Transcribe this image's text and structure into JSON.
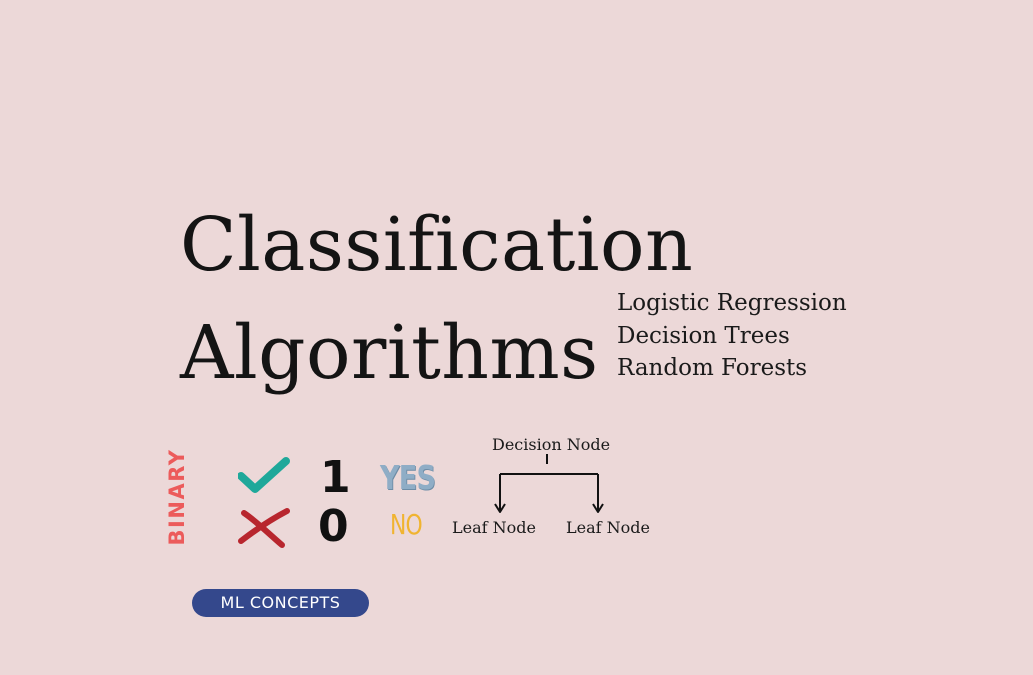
{
  "title": {
    "line1": "Classification",
    "line2": "Algorithms"
  },
  "algorithms": [
    "Logistic Regression",
    "Decision Trees",
    "Random Forests"
  ],
  "binary": {
    "label": "BINARY",
    "one": "1",
    "zero": "0",
    "yes": "YES",
    "no": "NO",
    "icons": [
      "check-icon",
      "cross-icon"
    ]
  },
  "tree": {
    "decision_node": "Decision Node",
    "leaf_left": "Leaf Node",
    "leaf_right": "Leaf Node"
  },
  "badge": "ML CONCEPTS",
  "colors": {
    "background": "#ecd8d8",
    "binary_label": "#ec5b5b",
    "check": "#1fa89a",
    "cross": "#b8262e",
    "yes": "#8fadc6",
    "no": "#f0b431",
    "badge_bg": "#34488c"
  }
}
